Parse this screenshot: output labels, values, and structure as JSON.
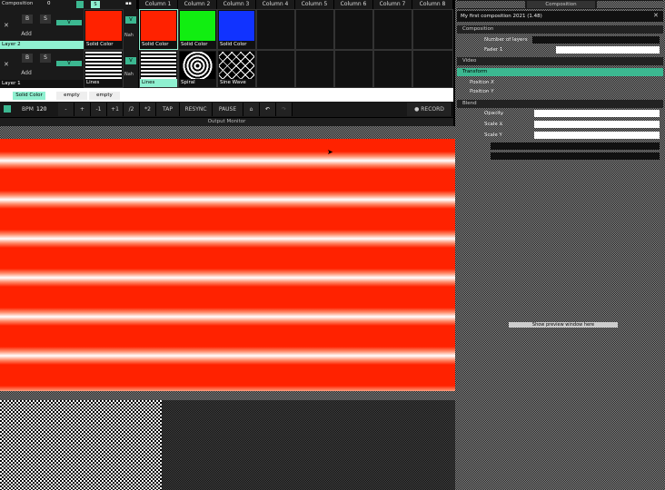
{
  "composition_menu": "Composition",
  "composition_value": "0",
  "layers": [
    {
      "name": "Layer 2",
      "add_label": "Add",
      "b_label": "B",
      "s_label": "S",
      "v_label": "V",
      "nah_label": "Nah"
    },
    {
      "name": "Layer 1",
      "add_label": "Add",
      "b_label": "B",
      "s_label": "S",
      "v_label": "V",
      "nah_label": "Nah"
    }
  ],
  "columns": [
    "Column 1",
    "Column 2",
    "Column 3",
    "Column 4",
    "Column 5",
    "Column 6",
    "Column 7",
    "Column 8"
  ],
  "preview_clips": {
    "layer2": "Solid Color",
    "layer1": "Lines"
  },
  "clips_row2": [
    "Solid Color",
    "Solid Color",
    "Solid Color"
  ],
  "clips_row1": [
    "Lines",
    "Spiral",
    "Sine Wave"
  ],
  "deck_tabs": [
    "Solid Color",
    "empty",
    "empty"
  ],
  "toolbar": {
    "bpm_label": "BPM",
    "bpm_value": "120",
    "minus": "-",
    "plus": "+",
    "minus1": "-1",
    "plus1": "+1",
    "div2": "/2",
    "mul2": "*2",
    "tap": "TAP",
    "resync": "RESYNC",
    "pause": "PAUSE",
    "record": "● RECORD"
  },
  "output_monitor_title": "Output Monitor",
  "right_panel": {
    "tabs": [
      "",
      "Composition",
      ""
    ],
    "file_title": "My first composition 2021 (1.48)",
    "sections": {
      "composition": "Composition",
      "video": "Video",
      "transform": "Transform",
      "blend": "Blend"
    },
    "props": [
      "Number of layers",
      "Fader 1",
      "Position X",
      "Position Y",
      "Opacity",
      "Scale X",
      "Scale Y"
    ],
    "empty_note": "Show preview window here"
  },
  "colors": {
    "accent": "#3cb891",
    "selected": "#8ff0d0",
    "red": "#ff2200",
    "green": "#11ee11",
    "blue": "#1133ff"
  }
}
